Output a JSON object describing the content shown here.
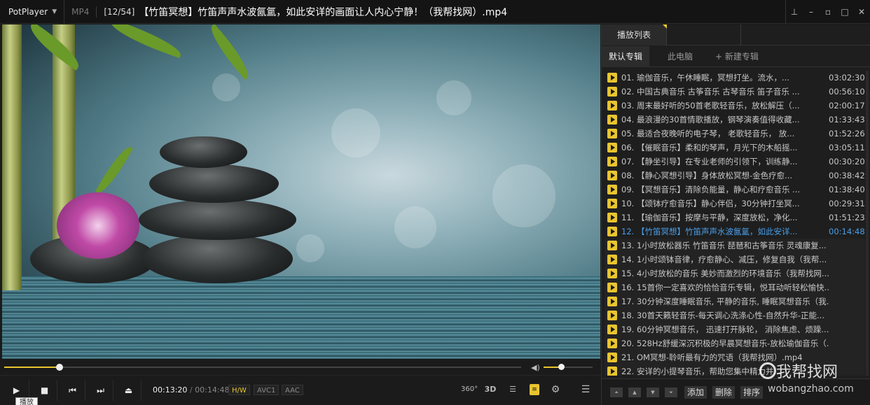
{
  "titlebar": {
    "app_name": "PotPlayer",
    "format": "MP4",
    "index": "[12/54]",
    "title": "【竹笛冥想】竹笛声声水波氤氲，如此安详的画面让人内心宁静！（我帮找网）.mp4",
    "controls": [
      "pin-icon",
      "minimize-icon",
      "mini-mode-icon",
      "maximize-icon",
      "close-icon"
    ]
  },
  "player": {
    "progress": 0.107,
    "volume": 0.35,
    "current_time": "00:13:20",
    "separator": "/",
    "duration": "00:14:48",
    "badges": [
      "H/W",
      "AVC1",
      "AAC"
    ],
    "tooltip": "播放",
    "buttons": [
      "play-icon",
      "stop-icon",
      "prev-icon",
      "next-icon",
      "eject-icon"
    ],
    "right_icons": [
      "360-icon",
      "3d-icon",
      "playlist-search-icon",
      "playlist-icon",
      "settings-icon",
      "menu-icon"
    ],
    "right_labels": {
      "vr": "360°",
      "three_d": "3D"
    }
  },
  "playlist": {
    "tab": "播放列表",
    "subtabs": [
      "默认专辑",
      "此电脑",
      "+ 新建专辑"
    ],
    "items": [
      {
        "title": "01. 瑜伽音乐，午休睡眠，冥想打坐。流水，...",
        "duration": "03:02:30"
      },
      {
        "title": "02. 中国古典音乐 古筝音乐 古琴音乐 笛子音乐 ...",
        "duration": "00:56:10"
      },
      {
        "title": "03. 周末最好听的50首老歌轻音乐，放松解压（...",
        "duration": "02:00:17"
      },
      {
        "title": "04. 最浪漫的30首情歌播放，钢琴演奏值得收藏...",
        "duration": "01:33:43"
      },
      {
        "title": "05. 最适合夜晚听的电子琴， 老歌轻音乐， 放...",
        "duration": "01:52:26"
      },
      {
        "title": "06. 【催眠音乐】柔和的琴声，月光下的木船摇...",
        "duration": "03:05:11"
      },
      {
        "title": "07. 【静坐引导】在专业老师的引领下，训练静...",
        "duration": "00:30:20"
      },
      {
        "title": "08. 【静心冥想引导】身体放松冥想-金色疗愈...",
        "duration": "00:38:42"
      },
      {
        "title": "09. 【冥想音乐】清除负能量，静心和疗愈音乐 ...",
        "duration": "01:38:40"
      },
      {
        "title": "10. 【颂钵疗愈音乐】静心伴侣，30分钟打坐冥...",
        "duration": "00:29:31"
      },
      {
        "title": "11. 【瑜伽音乐】按摩与平静，深度放松，净化...",
        "duration": "01:51:23"
      },
      {
        "title": "12. 【竹笛冥想】竹笛声声水波氤氲，如此安详...",
        "duration": "00:14:48"
      },
      {
        "title": "13. 1小时放松器乐 竹笛音乐 琵琶和古筝音乐 灵魂康复...",
        "duration": ""
      },
      {
        "title": "14. 1小时颂钵音律，疗愈静心、减压，修复自我（我帮...",
        "duration": ""
      },
      {
        "title": "15. 4小时放松的音乐 美妙而激烈的环境音乐（我帮找网...",
        "duration": ""
      },
      {
        "title": "16. 15首你一定喜欢的恰恰音乐专辑，悦耳动听轻松愉快...",
        "duration": ""
      },
      {
        "title": "17. 30分钟深度睡眠音乐, 平静的音乐, 睡眠冥想音乐（我...",
        "duration": ""
      },
      {
        "title": "18. 30首天籁轻音乐-每天调心洗涤心性-自然升华-正能...",
        "duration": ""
      },
      {
        "title": "19. 60分钟冥想音乐， 迅速打开脉轮， 消除焦虑、烦躁...",
        "duration": ""
      },
      {
        "title": "20. 528Hz舒缓深沉积极的早晨冥想音乐-放松瑜伽音乐（...",
        "duration": ""
      },
      {
        "title": "21. OM冥想-聆听最有力的咒语（我帮找网）.mp4",
        "duration": ""
      },
      {
        "title": "22. 安详的小提琴音乐，帮助您集中精力并...",
        "duration": ""
      }
    ],
    "current_index": 11,
    "bottom_buttons": [
      "添加",
      "删除",
      "排序"
    ],
    "bottom_icons": [
      "move-top-icon",
      "move-up-icon",
      "move-down-icon",
      "move-bottom-icon"
    ]
  },
  "watermark": {
    "main": "我帮找网",
    "sub": "wobangzhao.com"
  }
}
